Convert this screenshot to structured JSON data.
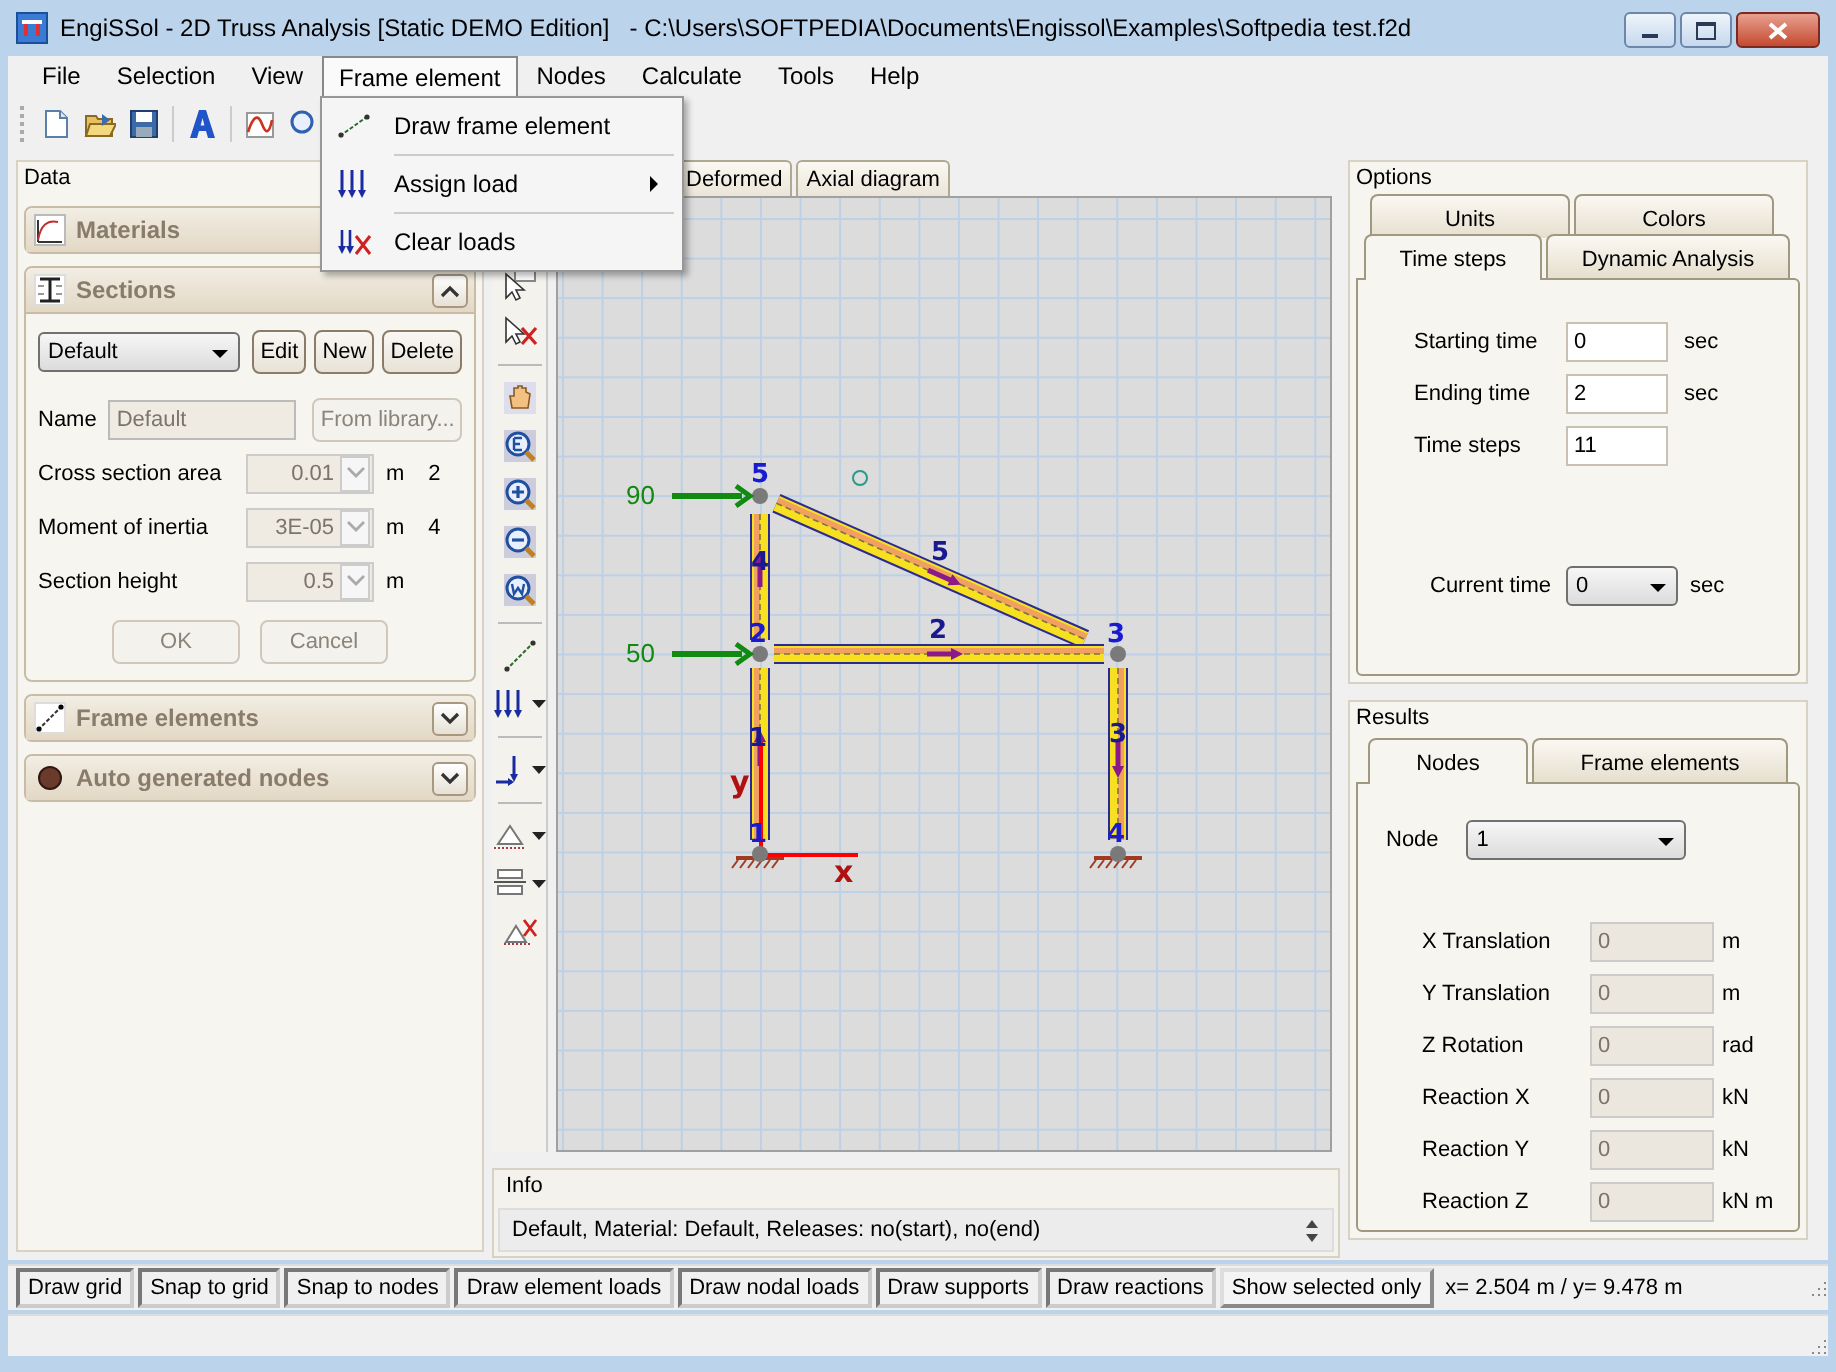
{
  "window": {
    "title": "EngiSSol - 2D Truss Analysis [Static DEMO Edition]   - C:\\Users\\SOFTPEDIA\\Documents\\Engissol\\Examples\\Softpedia test.f2d"
  },
  "menu": [
    {
      "label": "File",
      "selected": false
    },
    {
      "label": "Selection",
      "selected": false
    },
    {
      "label": "View",
      "selected": false
    },
    {
      "label": "Frame element",
      "selected": true
    },
    {
      "label": "Nodes",
      "selected": false
    },
    {
      "label": "Calculate",
      "selected": false
    },
    {
      "label": "Tools",
      "selected": false
    },
    {
      "label": "Help",
      "selected": false
    }
  ],
  "open_menu": {
    "items": [
      {
        "label": "Draw frame element",
        "submenu": false
      },
      {
        "label": "Assign load",
        "submenu": true
      },
      {
        "label": "Clear loads",
        "submenu": false
      }
    ]
  },
  "data_panel": {
    "title": "Data",
    "sections": [
      {
        "title": "Materials"
      },
      {
        "title": "Sections",
        "expanded": true,
        "form": {
          "section_select": {
            "value": "Default"
          },
          "buttons": [
            {
              "label": "Edit",
              "disabled": false
            },
            {
              "label": "New",
              "disabled": false
            },
            {
              "label": "Delete",
              "disabled": false
            }
          ],
          "name": {
            "label": "Name",
            "value": "Default",
            "disabled": true
          },
          "library_button": {
            "label": "From library...",
            "disabled": true
          },
          "properties": [
            {
              "label": "Cross section area",
              "value": "0.01",
              "unit": "m",
              "exponent": "2",
              "disabled": true
            },
            {
              "label": "Moment of inertia",
              "value": "3E-05",
              "unit": "m",
              "exponent": "4",
              "disabled": true
            },
            {
              "label": "Section height",
              "value": "0.5",
              "unit": "m",
              "disabled": true
            }
          ],
          "actions": [
            {
              "label": "OK",
              "disabled": true
            },
            {
              "label": "Cancel",
              "disabled": true
            }
          ]
        }
      },
      {
        "title": "Frame elements",
        "expanded": false
      },
      {
        "title": "Auto generated nodes",
        "expanded": false
      }
    ]
  },
  "canvas_tabs": [
    {
      "label": "Deformed",
      "selected": false
    },
    {
      "label": "Axial diagram",
      "selected": false
    }
  ],
  "structure": {
    "nodes": [
      {
        "label": "5"
      },
      {
        "label": "2"
      },
      {
        "label": "3"
      },
      {
        "label": "1"
      },
      {
        "label": "4"
      }
    ],
    "elements": [
      {
        "label": "4"
      },
      {
        "label": "5"
      },
      {
        "label": "2"
      },
      {
        "label": "1"
      },
      {
        "label": "3"
      }
    ],
    "loads": [
      {
        "value": "90"
      },
      {
        "value": "50"
      }
    ],
    "axes": {
      "x": "x",
      "y": "y"
    }
  },
  "info": {
    "title": "Info",
    "text": "Default, Material: Default, Releases: no(start), no(end)"
  },
  "options": {
    "title": "Options",
    "tab_rows": [
      {
        "tabs": [
          {
            "label": "Units",
            "selected": false
          },
          {
            "label": "Colors",
            "selected": false
          }
        ]
      },
      {
        "tabs": [
          {
            "label": "Time steps",
            "selected": true
          },
          {
            "label": "Dynamic Analysis",
            "selected": false
          }
        ]
      }
    ],
    "fields": [
      {
        "label": "Starting time",
        "value": "0",
        "unit": "sec"
      },
      {
        "label": "Ending time",
        "value": "2",
        "unit": "sec"
      },
      {
        "label": "Time steps",
        "value": "11"
      }
    ],
    "current_time": {
      "label": "Current time",
      "value": "0",
      "unit": "sec"
    }
  },
  "results": {
    "title": "Results",
    "tabs": [
      {
        "label": "Nodes",
        "selected": true
      },
      {
        "label": "Frame elements",
        "selected": false
      }
    ],
    "node_select": {
      "label": "Node",
      "value": "1"
    },
    "rows": [
      {
        "label": "X Translation",
        "value": "0",
        "unit": "m",
        "disabled": true
      },
      {
        "label": "Y Translation",
        "value": "0",
        "unit": "m",
        "disabled": true
      },
      {
        "label": "Z Rotation",
        "value": "0",
        "unit": "rad",
        "disabled": true
      },
      {
        "label": "Reaction X",
        "value": "0",
        "unit": "kN",
        "disabled": true
      },
      {
        "label": "Reaction Y",
        "value": "0",
        "unit": "kN",
        "disabled": true
      },
      {
        "label": "Reaction Z",
        "value": "0",
        "unit": "kN m",
        "disabled": true
      }
    ]
  },
  "status_bar": {
    "toggles": [
      {
        "label": "Draw grid",
        "on": true
      },
      {
        "label": "Snap to grid",
        "on": true
      },
      {
        "label": "Snap to nodes",
        "on": true
      },
      {
        "label": "Draw element loads",
        "on": true
      },
      {
        "label": "Draw nodal loads",
        "on": true
      },
      {
        "label": "Draw supports",
        "on": true
      },
      {
        "label": "Draw reactions",
        "on": true
      },
      {
        "label": "Show selected only",
        "on": false
      }
    ],
    "coordinates": "x= 2.504 m / y= 9.478 m"
  }
}
